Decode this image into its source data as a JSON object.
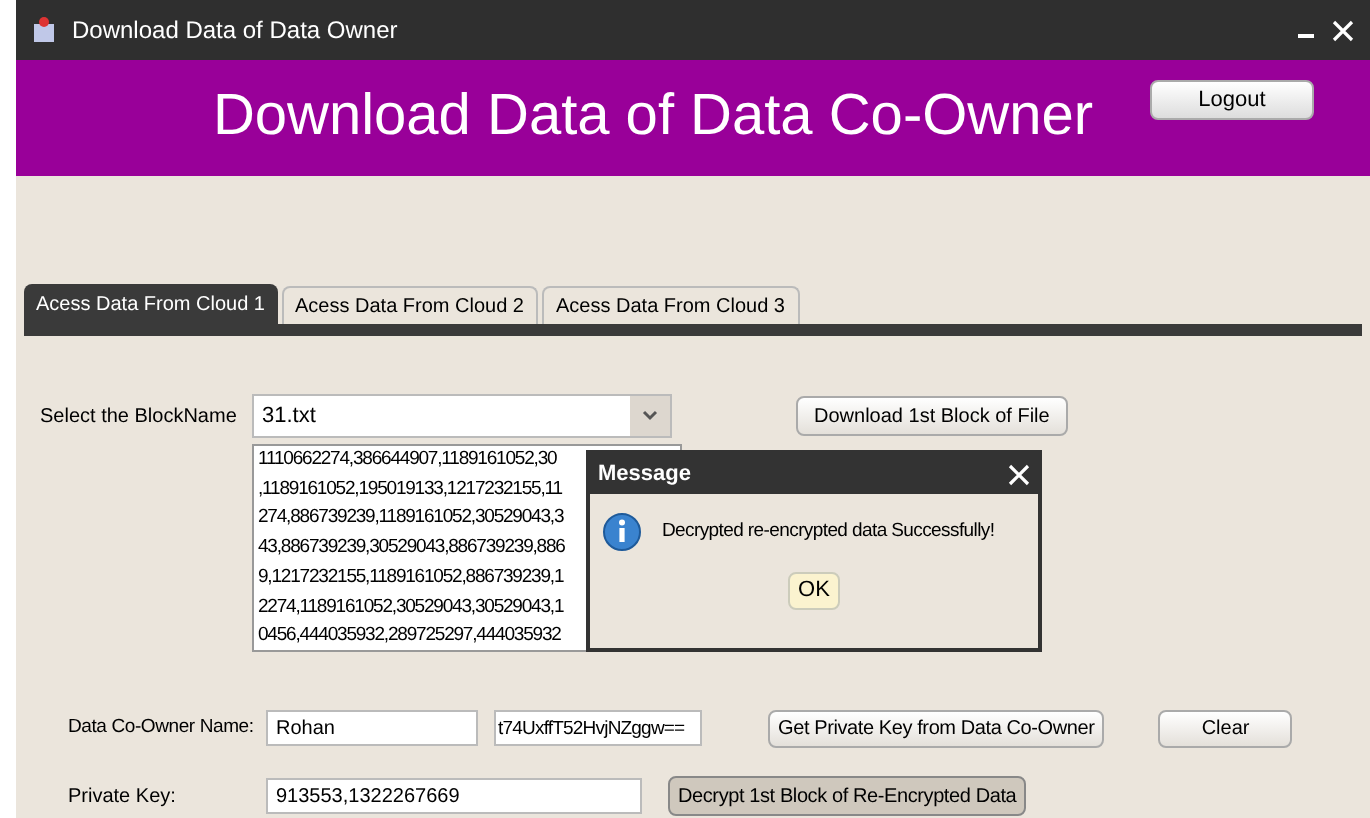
{
  "window": {
    "title": "Download Data of Data Owner"
  },
  "header": {
    "title": "Download Data of Data Co-Owner",
    "logout": "Logout"
  },
  "tabs": [
    {
      "label": "Acess Data From Cloud 1",
      "selected": true
    },
    {
      "label": "Acess Data From Cloud 2",
      "selected": false
    },
    {
      "label": "Acess Data From Cloud 3",
      "selected": false
    }
  ],
  "block": {
    "label": "Select the BlockName",
    "value": "31.txt",
    "download": "Download 1st Block of File"
  },
  "data_lines": [
    "1110662274,386644907,1189161052,30",
    ",1189161052,195019133,1217232155,11",
    "274,886739239,1189161052,30529043,3",
    "43,886739239,30529043,886739239,886",
    "9,1217232155,1189161052,886739239,1",
    "2274,1189161052,30529043,30529043,1",
    "0456,444035932,289725297,444035932"
  ],
  "dialog": {
    "title": "Message",
    "message": "Decrypted re-encrypted data Successfully!",
    "ok": "OK"
  },
  "co_owner": {
    "label": "Data Co-Owner Name:",
    "name": "Rohan",
    "key": "t74UxffT52HvjNZggw==",
    "get_key": "Get Private Key from Data Co-Owner",
    "clear": "Clear"
  },
  "private_key": {
    "label": "Private Key:",
    "value": "913553,1322267669",
    "decrypt": "Decrypt 1st Block of  Re-Encrypted Data"
  }
}
